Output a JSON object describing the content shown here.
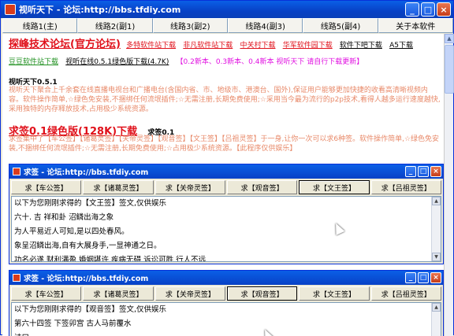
{
  "window": {
    "title": "视听天下 - 论坛:http://bbs.tfdiy.com",
    "minimize": "_",
    "maximize": "□",
    "close": "×"
  },
  "tabs": [
    "线路1(主)",
    "线路2(副1)",
    "线路3(副2)",
    "线路4(副3)",
    "线路5(副4)",
    "关于本软件"
  ],
  "header": {
    "title": "探峰技术论坛(官方论坛)",
    "links1": [
      "多特软件站下载",
      "非凡软件站下载",
      "中关村下载",
      "华军软件园下载",
      "软件下吧下载",
      "A5下载"
    ],
    "links2": [
      "豆豆软件站下载",
      "视听在线0.5.1绿色版下载(4.7K)"
    ],
    "version_note": "【0.2新本、0.3新本、0.4新本 视听天下 请自行下载更新】"
  },
  "tv_section": {
    "title": "视听天下0.5.1",
    "desc": "视听天下聚合上千余套在线直播电视台和广播电台(含国内省、市、地级市、港澳台、国外),保证用户能够更加快捷的收看高清晰视频内容。软件操作简单,☆绿色免安装,不捆绑任何流氓插件;☆无需注册,长期免费使用;☆采用当今最为流行的p2p技术,看得人越多运行速度越快,采用独特的内存释放技术,占用极少系统资源。"
  },
  "qq_section": {
    "title": "求签0.1绿色版(128K)下载",
    "version": "求签0.1",
    "desc": "求签集中了【车公签】【诸葛灵签】【关帝灵签】【观音签】【文王签】【吕祖灵签】于一身,让你一次可以求6种签。软件操作简单,☆绿色免安装,不捆绑任何流氓插件;☆无需注册,长期免费使用;☆占用极少系统资源。【此程序仅供娱乐】"
  },
  "child1": {
    "title": "求签 - 论坛:http://bbs.tfdiy.com",
    "buttons": [
      "求【车公签】",
      "求【诸葛灵签】",
      "求【关帝灵签】",
      "求【观音签】",
      "求【文王签】",
      "求【吕祖灵签】"
    ],
    "active_index": 4,
    "lines": [
      "以下为您刚刚求得的【文王签】签文,仅供娱乐",
      "  六十. 吉   祥和卦    沼鳞出海之象",
      "为人平易近人可知,是以四处春风。",
      "象呈沼鳞出海,自有大展身手,一显神通之日。",
      "功名必遂    财利满盈    婚姻堪许    疾病无碍    诉讼可胜    行人不远"
    ]
  },
  "child2": {
    "title": "求签 - 论坛:http://bbs.tfdiy.com",
    "buttons": [
      "求【车公签】",
      "求【诸葛灵签】",
      "求【关帝灵签】",
      "求【观音签】",
      "求【文王签】",
      "求【吕祖灵签】"
    ],
    "active_index": 3,
    "lines": [
      "以下为您刚刚求得的【观音签】签文,仅供娱乐",
      "     第六十四签    下签卯宫    古人马前覆水",
      "     诗曰"
    ]
  }
}
